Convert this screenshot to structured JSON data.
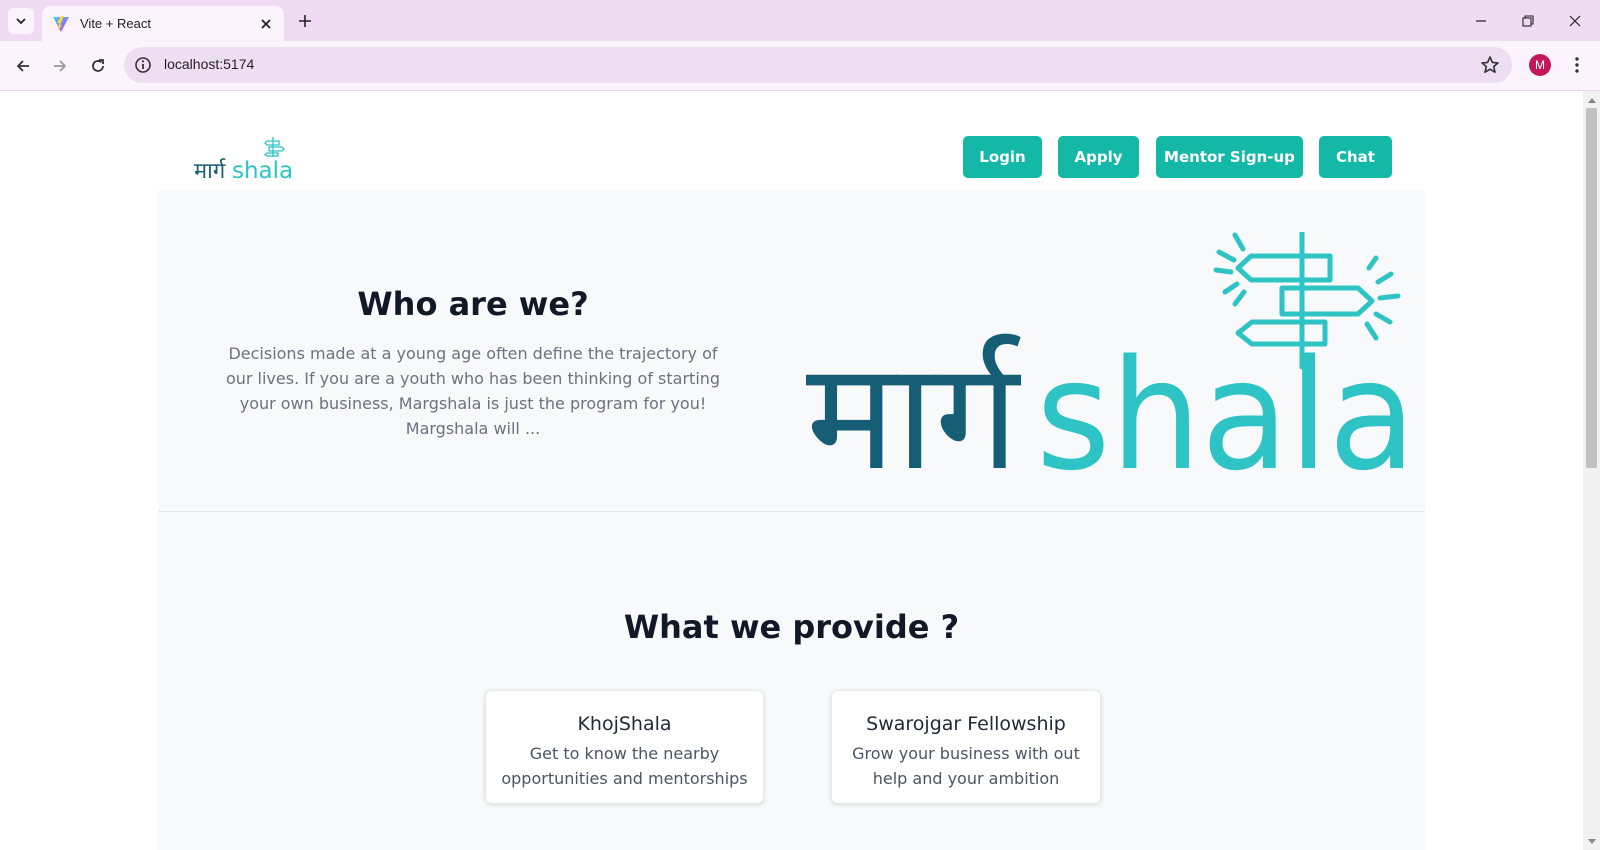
{
  "browser": {
    "tab_title": "Vite + React",
    "url": "localhost:5174",
    "profile_initial": "M"
  },
  "header": {
    "logo": {
      "hindi": "मार्ग",
      "latin": "shala"
    },
    "buttons": [
      {
        "label": "Login"
      },
      {
        "label": "Apply"
      },
      {
        "label": "Mentor Sign-up"
      },
      {
        "label": "Chat"
      }
    ]
  },
  "hero": {
    "title": "Who are we?",
    "description": "Decisions made at a young age often define the trajectory of our lives. If you are a youth who has been thinking of starting your own business, Margshala is just the program for you! Margshala will ...",
    "logo": {
      "hindi": "मार्ग",
      "latin": "shala"
    }
  },
  "provide": {
    "title": "What we provide ?",
    "cards": [
      {
        "title": "KhojShala",
        "description": "Get to know the nearby opportunities and mentorships"
      },
      {
        "title": "Swarojgar Fellowship",
        "description": "Grow your business with out help and your ambition"
      }
    ]
  },
  "colors": {
    "accent": "#14b8a6",
    "logo_dark": "#155e75",
    "logo_light": "#2ec4c6",
    "chrome_bg": "#efdcf3"
  },
  "icons": [
    "tab-list-icon",
    "vite-favicon-icon",
    "close-icon",
    "plus-icon",
    "minimize-icon",
    "restore-icon",
    "window-close-icon",
    "back-icon",
    "forward-icon",
    "reload-icon",
    "site-info-icon",
    "star-icon",
    "more-vert-icon",
    "signpost-icon"
  ]
}
